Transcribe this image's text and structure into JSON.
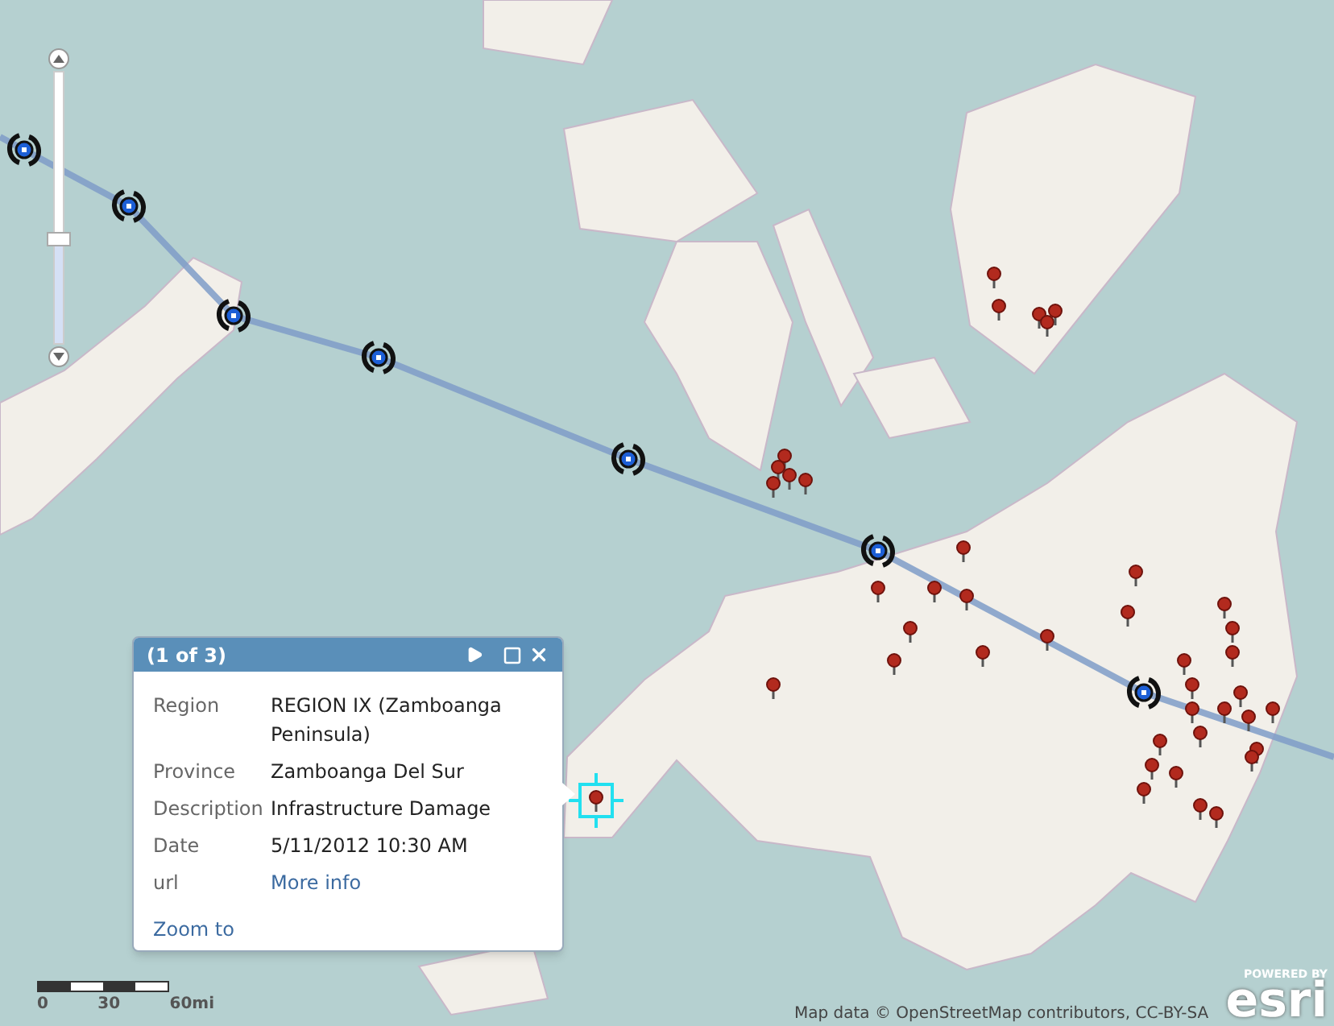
{
  "map": {
    "zoom_slider": {
      "level": 0.39
    },
    "popup": {
      "title": "(1 of 3)",
      "fields": [
        {
          "label": "Region",
          "value": "REGION IX (Zamboanga Peninsula)",
          "kind": "text"
        },
        {
          "label": "Province",
          "value": "Zamboanga Del Sur",
          "kind": "text"
        },
        {
          "label": "Description",
          "value": "Infrastructure Damage",
          "kind": "text"
        },
        {
          "label": "Date",
          "value": "5/11/2012 10:30 AM",
          "kind": "text"
        },
        {
          "label": "url",
          "value": "More info",
          "kind": "link"
        }
      ],
      "zoom_link": "Zoom to"
    },
    "scale_bar": {
      "labels": [
        "0",
        "30",
        "60mi"
      ]
    },
    "attribution": "Map data © OpenStreetMap contributors, CC-BY-SA",
    "logo": {
      "tagline": "POWERED BY",
      "wordmark": "esri"
    }
  }
}
